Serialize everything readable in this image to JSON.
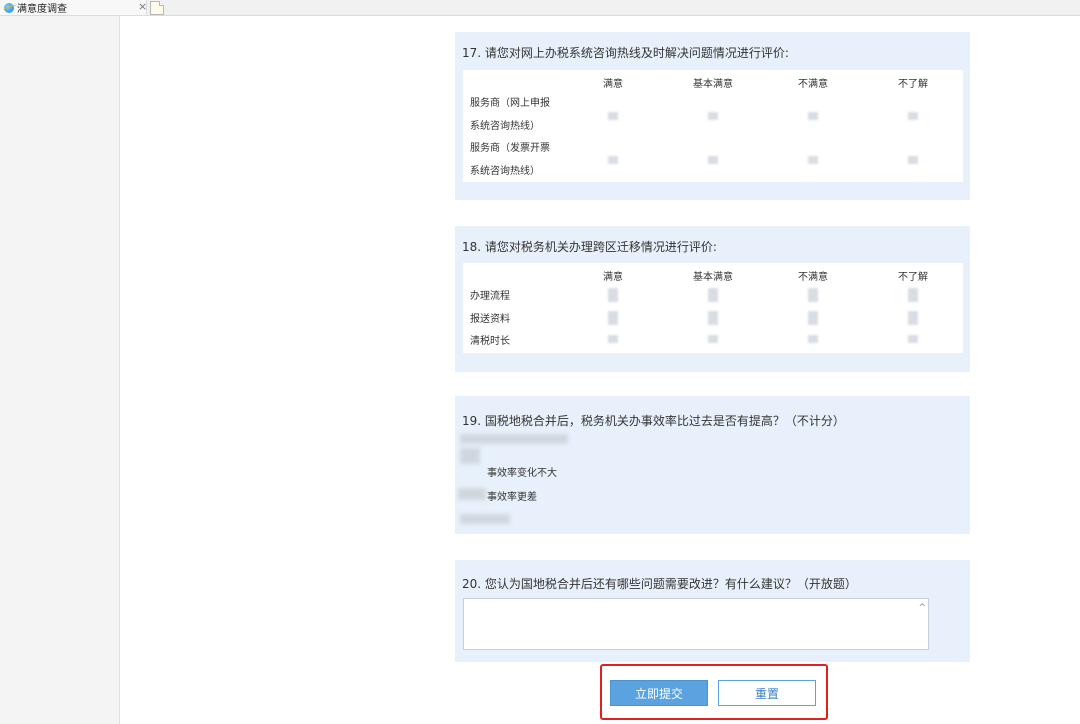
{
  "tab": {
    "title": "满意度调查",
    "close": "×"
  },
  "q17": {
    "title": "17. 请您对网上办税系统咨询热线及时解决问题情况进行评价:",
    "columns": [
      "满意",
      "基本满意",
      "不满意",
      "不了解"
    ],
    "rows": [
      {
        "line1": "服务商（网上申报",
        "line2": "系统咨询热线）"
      },
      {
        "line1": "服务商（发票开票",
        "line2": "系统咨询热线）"
      }
    ]
  },
  "q18": {
    "title": "18. 请您对税务机关办理跨区迁移情况进行评价:",
    "columns": [
      "满意",
      "基本满意",
      "不满意",
      "不了解"
    ],
    "rows": [
      "办理流程",
      "报送资料",
      "清税时长"
    ]
  },
  "q19": {
    "title": "19. 国税地税合并后，税务机关办事效率比过去是否有提高？（不计分）",
    "options": [
      "事效率变化不大",
      "事效率更差"
    ]
  },
  "q20": {
    "title": "20. 您认为国地税合并后还有哪些问题需要改进？有什么建议？（开放题）",
    "textarea_value": ""
  },
  "buttons": {
    "submit": "立即提交",
    "reset": "重置"
  },
  "icons": {
    "tab": "ie-browser-icon",
    "newtab": "new-tab-icon"
  }
}
